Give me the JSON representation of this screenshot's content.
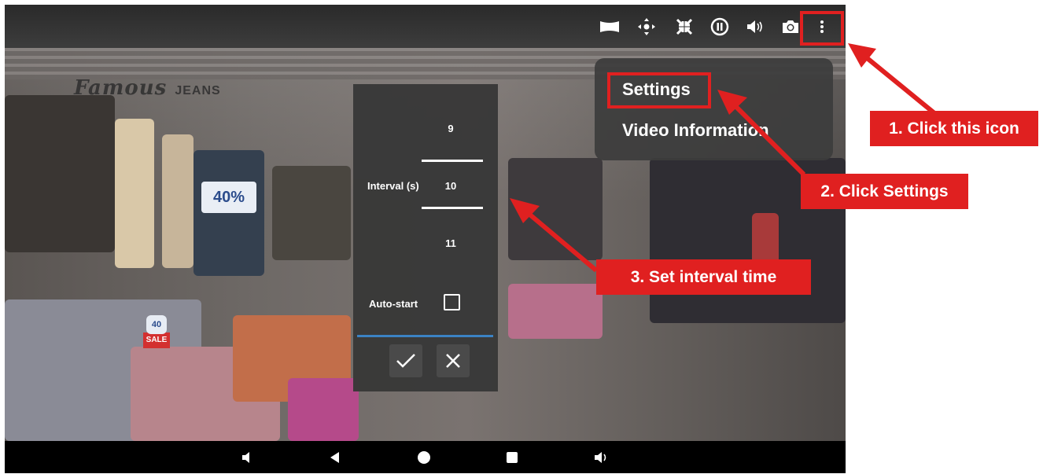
{
  "menu": {
    "settings_label": "Settings",
    "video_info_label": "Video Information"
  },
  "settings_dialog": {
    "interval_label": "Interval (s)",
    "interval_prev": "9",
    "interval_value": "10",
    "interval_next": "11",
    "autostart_label": "Auto-start",
    "autostart_checked": false
  },
  "scene": {
    "brand_sign": "Famous",
    "brand_sign_suffix": "JEANS",
    "price_sign": "40%",
    "sale_sign": "SALE",
    "small_price": "40"
  },
  "toolbar": {
    "icons": [
      "panorama-icon",
      "move-icon",
      "collapse-icon",
      "pause-icon",
      "volume-icon",
      "camera-icon",
      "more-vertical-icon"
    ]
  },
  "navbar": {
    "icons": [
      "volume-down-icon",
      "back-icon",
      "home-icon",
      "recents-icon",
      "volume-up-icon"
    ]
  },
  "annotations": {
    "step1": "1. Click this icon",
    "step2": "2. Click Settings",
    "step3": "3. Set interval time",
    "color": "#e02020"
  },
  "colors": {
    "accent_blue": "#3b82c4",
    "dialog_bg": "#373737",
    "annotation_red": "#e02020"
  }
}
